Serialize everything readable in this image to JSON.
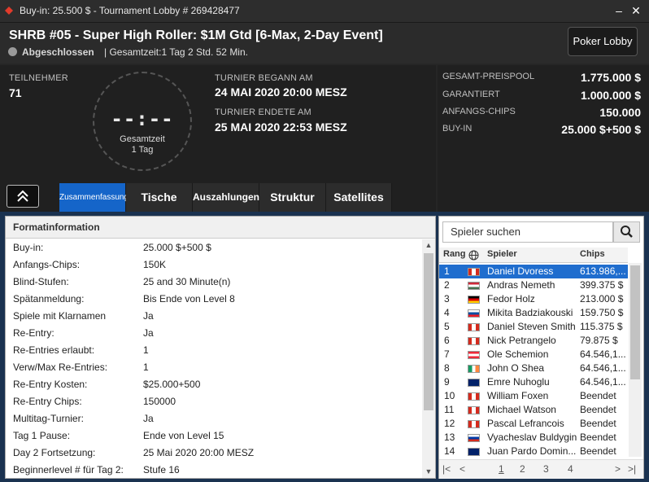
{
  "titlebar": {
    "title": "Buy-in: 25.500 $ - Tournament Lobby # 269428477",
    "minimize": "–",
    "close": "✕"
  },
  "header": {
    "tournament_name": "SHRB #05 - Super High Roller: $1M Gtd [6-Max, 2-Day Event]",
    "status": "Abgeschlossen",
    "total_time": "| Gesamtzeit:1 Tag 2 Std.  52 Min.",
    "poker_lobby_button": "Poker Lobby"
  },
  "info": {
    "participants_label": "TEILNEHMER",
    "participants_value": "71",
    "clock_digits": "--:--",
    "clock_label": "Gesamtzeit",
    "clock_sub": "1 Tag",
    "began_label": "TURNIER BEGANN AM",
    "began_value": "24 MAI 2020  20:00 MESZ",
    "ended_label": "TURNIER ENDETE AM",
    "ended_value": "25 MAI 2020  22:53 MESZ"
  },
  "prize": {
    "rows": [
      {
        "label": "GESAMT-PREISPOOL",
        "value": "1.775.000 $"
      },
      {
        "label": "GARANTIERT",
        "value": "1.000.000 $"
      },
      {
        "label": "ANFANGS-CHIPS",
        "value": "150.000"
      },
      {
        "label": "BUY-IN",
        "value": "25.000 $+500 $"
      }
    ]
  },
  "tabs": [
    {
      "label": "Zusammenfassung",
      "active": true
    },
    {
      "label": "Tische",
      "active": false
    },
    {
      "label": "Auszahlungen",
      "active": false
    },
    {
      "label": "Struktur",
      "active": false
    },
    {
      "label": "Satellites",
      "active": false
    }
  ],
  "format": {
    "title": "Formatinformation",
    "rows": [
      {
        "label": "Buy-in:",
        "value": "25.000 $+500 $"
      },
      {
        "label": "Anfangs-Chips:",
        "value": "150K"
      },
      {
        "label": "Blind-Stufen:",
        "value": "25 and 30 Minute(n)"
      },
      {
        "label": "Spätanmeldung:",
        "value": "Bis Ende von Level 8"
      },
      {
        "label": "Spiele mit Klarnamen",
        "value": "Ja"
      },
      {
        "label": "Re-Entry:",
        "value": "Ja"
      },
      {
        "label": "Re-Entries erlaubt:",
        "value": "1"
      },
      {
        "label": "Verw/Max Re-Entries:",
        "value": "1"
      },
      {
        "label": "Re-Entry Kosten:",
        "value": "$25.000+500"
      },
      {
        "label": "Re-Entry Chips:",
        "value": "150000"
      },
      {
        "label": "Multitag-Turnier:",
        "value": "Ja"
      },
      {
        "label": "Tag 1 Pause:",
        "value": "Ende von Level 15"
      },
      {
        "label": "Day 2 Fortsetzung:",
        "value": "25 Mai 2020  20:00 MESZ"
      },
      {
        "label": "Beginnerlevel # für Tag 2:",
        "value": "Stufe 16"
      }
    ]
  },
  "players": {
    "search_placeholder": "Spieler suchen",
    "columns": {
      "rank": "Rang",
      "player": "Spieler",
      "chips": "Chips"
    },
    "rows": [
      {
        "rank": "1",
        "name": "Daniel Dvoress",
        "chips": "613.986,...",
        "flag": "CA"
      },
      {
        "rank": "2",
        "name": "Andras Nemeth",
        "chips": "399.375 $",
        "flag": "HU"
      },
      {
        "rank": "3",
        "name": "Fedor Holz",
        "chips": "213.000 $",
        "flag": "DE"
      },
      {
        "rank": "4",
        "name": "Mikita Badziakouski",
        "chips": "159.750 $",
        "flag": "SK"
      },
      {
        "rank": "5",
        "name": "Daniel Steven Smith",
        "chips": "115.375 $",
        "flag": "CA"
      },
      {
        "rank": "6",
        "name": "Nick Petrangelo",
        "chips": "79.875 $",
        "flag": "CA"
      },
      {
        "rank": "7",
        "name": "Ole Schemion",
        "chips": "64.546,1...",
        "flag": "AT"
      },
      {
        "rank": "8",
        "name": "John O Shea",
        "chips": "64.546,1...",
        "flag": "IE"
      },
      {
        "rank": "9",
        "name": "Emre Nuhoglu",
        "chips": "64.546,1...",
        "flag": "GB"
      },
      {
        "rank": "10",
        "name": "William Foxen",
        "chips": "Beendet",
        "flag": "CA"
      },
      {
        "rank": "11",
        "name": "Michael Watson",
        "chips": "Beendet",
        "flag": "CA"
      },
      {
        "rank": "12",
        "name": "Pascal Lefrancois",
        "chips": "Beendet",
        "flag": "CA"
      },
      {
        "rank": "13",
        "name": "Vyacheslav Buldygin",
        "chips": "Beendet",
        "flag": "RU"
      },
      {
        "rank": "14",
        "name": "Juan Pardo Domin...",
        "chips": "Beendet",
        "flag": "GB"
      }
    ],
    "pages": [
      "1",
      "2",
      "3",
      "4"
    ],
    "current_page": "1"
  },
  "colors": {
    "accent": "#1565c9",
    "selected_row": "#1f6dce",
    "brand_red": "#e23b2b"
  }
}
